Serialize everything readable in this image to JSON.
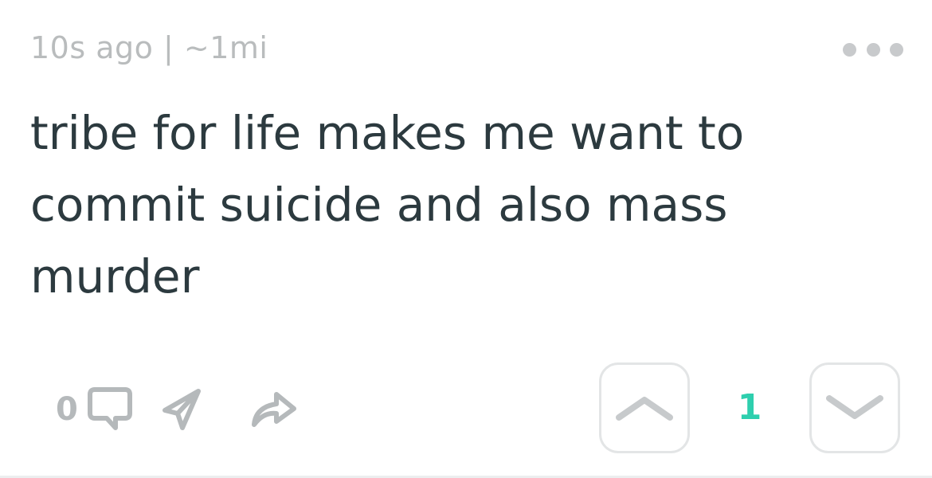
{
  "post": {
    "time": "10s ago",
    "separator": "|",
    "distance": "~1mi",
    "text_lines": [
      "tribe for life makes me want to",
      "commit suicide and also mass",
      "murder"
    ],
    "comment_count": "0",
    "score": "1"
  },
  "icons": {
    "more": "more-dots-icon",
    "comment": "comment-bubble-icon",
    "send": "send-paper-plane-icon",
    "share": "share-arrow-icon",
    "upvote": "chevron-up-icon",
    "downvote": "chevron-down-icon"
  },
  "colors": {
    "text": "#2c3a3f",
    "meta": "#b9bcbd",
    "icon": "#b5b9bb",
    "accent": "#2ecfae",
    "border": "#e3e5e6"
  }
}
